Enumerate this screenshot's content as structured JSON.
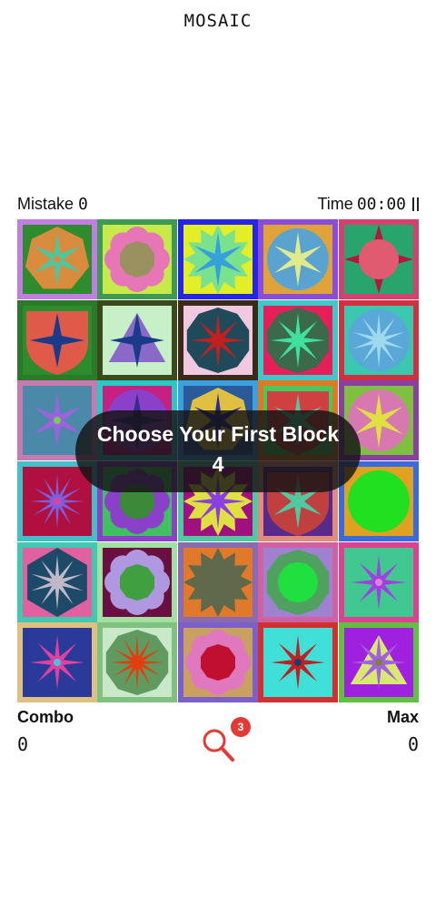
{
  "app": {
    "title": "MOSAIC"
  },
  "stats": {
    "mistake_label": "Mistake",
    "mistake_value": "0",
    "time_label": "Time",
    "time_value": "00:00"
  },
  "overlay": {
    "message": "Choose Your First Block",
    "countdown": "4"
  },
  "bottom": {
    "combo_label": "Combo",
    "combo_value": "0",
    "max_label": "Max",
    "max_value": "0",
    "hint_count": "3"
  },
  "icons": {
    "pause": "pause-icon",
    "hint": "magnifier-icon"
  },
  "colors": {
    "hint_red": "#e53935",
    "overlay_bg": "#141414"
  },
  "tiles": [
    {
      "frame": "#c17de1",
      "bg": "#2e8b2e",
      "shape": "hept",
      "c1": "#d98b3e",
      "star": "#4ac8a0",
      "n": 6,
      "c3": "#d98b3e"
    },
    {
      "frame": "#3c9a52",
      "bg": "#c8e94a",
      "shape": "flower",
      "c1": "#e776b6",
      "star": "#9a9060",
      "n": 0,
      "c3": "#9a9060"
    },
    {
      "frame": "#2525e6",
      "bg": "#e3ee26",
      "shape": "star12",
      "c1": "#7ae18e",
      "star": "#35a1d8",
      "n": 6,
      "c3": "#35a1d8"
    },
    {
      "frame": "#8a4dd8",
      "bg": "#e0a33a",
      "shape": "circle",
      "c1": "#5aa2d0",
      "star": "#e0ea8a",
      "n": 6,
      "c3": "#e0ea8a"
    },
    {
      "frame": "#d6406f",
      "bg": "#27a56d",
      "shape": "star4",
      "c1": "#b0193e",
      "star": "#e05b70",
      "n": 0,
      "c3": "#b0193e"
    },
    {
      "frame": "#2a7a2a",
      "bg": "#2e8b2e",
      "shape": "shield",
      "c1": "#e05a4a",
      "star": "#1b3b8a",
      "n": 4,
      "c3": "#1b3b8a"
    },
    {
      "frame": "#3a4a1a",
      "bg": "#c8f0c8",
      "shape": "tri",
      "c1": "#8a6ac8",
      "star": "#1b3b8a",
      "n": 4,
      "c3": "#1b3b8a"
    },
    {
      "frame": "#3a2a1a",
      "bg": "#f0c8e0",
      "shape": "dec",
      "c1": "#1e4a5a",
      "star": "#c02020",
      "n": 8,
      "c3": "#c02020"
    },
    {
      "frame": "#40c8c8",
      "bg": "#e61e5a",
      "shape": "dec",
      "c1": "#3a6a4a",
      "star": "#40e0a0",
      "n": 8,
      "c3": "#40e0a0"
    },
    {
      "frame": "#d03040",
      "bg": "#3ac8b0",
      "shape": "circle",
      "c1": "#5aa8d8",
      "star": "#a0d8f0",
      "n": 10,
      "c3": "#a0d8f0"
    },
    {
      "frame": "#c87ab0",
      "bg": "#4a8aa8",
      "shape": "none",
      "c1": "#4a8aa8",
      "star": "#a060e0",
      "n": 6,
      "c3": "#70d050"
    },
    {
      "frame": "#28c8c8",
      "bg": "#c82080",
      "shape": "circle",
      "c1": "#8a40c8",
      "star": "#3a2a8a",
      "n": 4,
      "c3": "#3a2a8a"
    },
    {
      "frame": "#3aa0e0",
      "bg": "#2a5a9a",
      "shape": "hept",
      "c1": "#e0c040",
      "star": "#2a2a9a",
      "n": 6,
      "c3": "#2a2a9a"
    },
    {
      "frame": "#e07a20",
      "bg": "#4ac860",
      "shape": "shield",
      "c1": "#d04040",
      "star": "#50c8a0",
      "n": 6,
      "c3": "#50c8a0"
    },
    {
      "frame": "#8a40a0",
      "bg": "#80c040",
      "shape": "circle",
      "c1": "#d878b0",
      "star": "#e0e040",
      "n": 6,
      "c3": "#e0e040"
    },
    {
      "frame": "#40c0c8",
      "bg": "#b01040",
      "shape": "none",
      "c1": "#b01040",
      "star": "#7a60e0",
      "n": 12,
      "c3": "#e040a0"
    },
    {
      "frame": "#8a40c8",
      "bg": "#40c060",
      "shape": "flower",
      "c1": "#8a40c8",
      "star": "#3a8a3a",
      "n": 0,
      "c3": "#3a8a3a"
    },
    {
      "frame": "#50c8a0",
      "bg": "#a01080",
      "shape": "star12",
      "c1": "#e0e040",
      "star": "#8a40e0",
      "n": 8,
      "c3": "#8a40e0"
    },
    {
      "frame": "#e08a80",
      "bg": "#5a2a8a",
      "shape": "shield",
      "c1": "#c04040",
      "star": "#50c8a0",
      "n": 6,
      "c3": "#50c8a0"
    },
    {
      "frame": "#3a6ae0",
      "bg": "#e0a020",
      "shape": "circle",
      "c1": "#20e020",
      "star": "#20e020",
      "n": 0,
      "c3": "#20e020"
    },
    {
      "frame": "#40c8b0",
      "bg": "#e060a0",
      "shape": "hex",
      "c1": "#1e4a6a",
      "star": "#c0b8c8",
      "n": 10,
      "c3": "#c0b8c8"
    },
    {
      "frame": "#a0e0a0",
      "bg": "#6a1040",
      "shape": "flower",
      "c1": "#b098e0",
      "star": "#40a040",
      "n": 0,
      "c3": "#40a040"
    },
    {
      "frame": "#8a6ab0",
      "bg": "#e07a2a",
      "shape": "star12",
      "c1": "#606a4a",
      "star": "#606a4a",
      "n": 0,
      "c3": "#606a4a"
    },
    {
      "frame": "#d060a0",
      "bg": "#a080d0",
      "shape": "dec",
      "c1": "#50a060",
      "star": "#20e040",
      "n": 0,
      "c3": "#20e040"
    },
    {
      "frame": "#e04090",
      "bg": "#40c890",
      "shape": "none",
      "c1": "#40c890",
      "star": "#a040e0",
      "n": 8,
      "c3": "#e080e0"
    },
    {
      "frame": "#e0c080",
      "bg": "#2a3a9a",
      "shape": "none",
      "c1": "#2a3a9a",
      "star": "#e040a0",
      "n": 8,
      "c3": "#40c8e0"
    },
    {
      "frame": "#80c080",
      "bg": "#c8e8c8",
      "shape": "dec",
      "c1": "#609a60",
      "star": "#e04010",
      "n": 12,
      "c3": "#e04010"
    },
    {
      "frame": "#7a60c8",
      "bg": "#c8a060",
      "shape": "flower",
      "c1": "#e078c0",
      "star": "#c01030",
      "n": 0,
      "c3": "#c01030"
    },
    {
      "frame": "#d03030",
      "bg": "#40e0d8",
      "shape": "none",
      "c1": "#40e0d8",
      "star": "#c02020",
      "n": 8,
      "c3": "#203a6a"
    },
    {
      "frame": "#60c040",
      "bg": "#a020e0",
      "shape": "tri",
      "c1": "#d8e870",
      "star": "#a060e0",
      "n": 8,
      "c3": "#808040"
    }
  ]
}
